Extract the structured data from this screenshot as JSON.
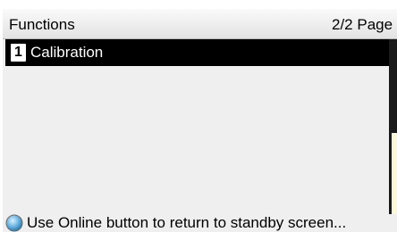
{
  "header": {
    "title": "Functions",
    "page_indicator": "2/2 Page"
  },
  "menu": {
    "items": [
      {
        "number": "1",
        "label": "Calibration",
        "selected": true
      }
    ]
  },
  "footer": {
    "hint": "Use Online button to return to standby screen...",
    "icon": "online-button-icon"
  },
  "colors": {
    "selection": "#000000",
    "background": "#efefef",
    "scroll_thumb": "#fbf7d9",
    "online_icon": "#5aa6d8"
  }
}
